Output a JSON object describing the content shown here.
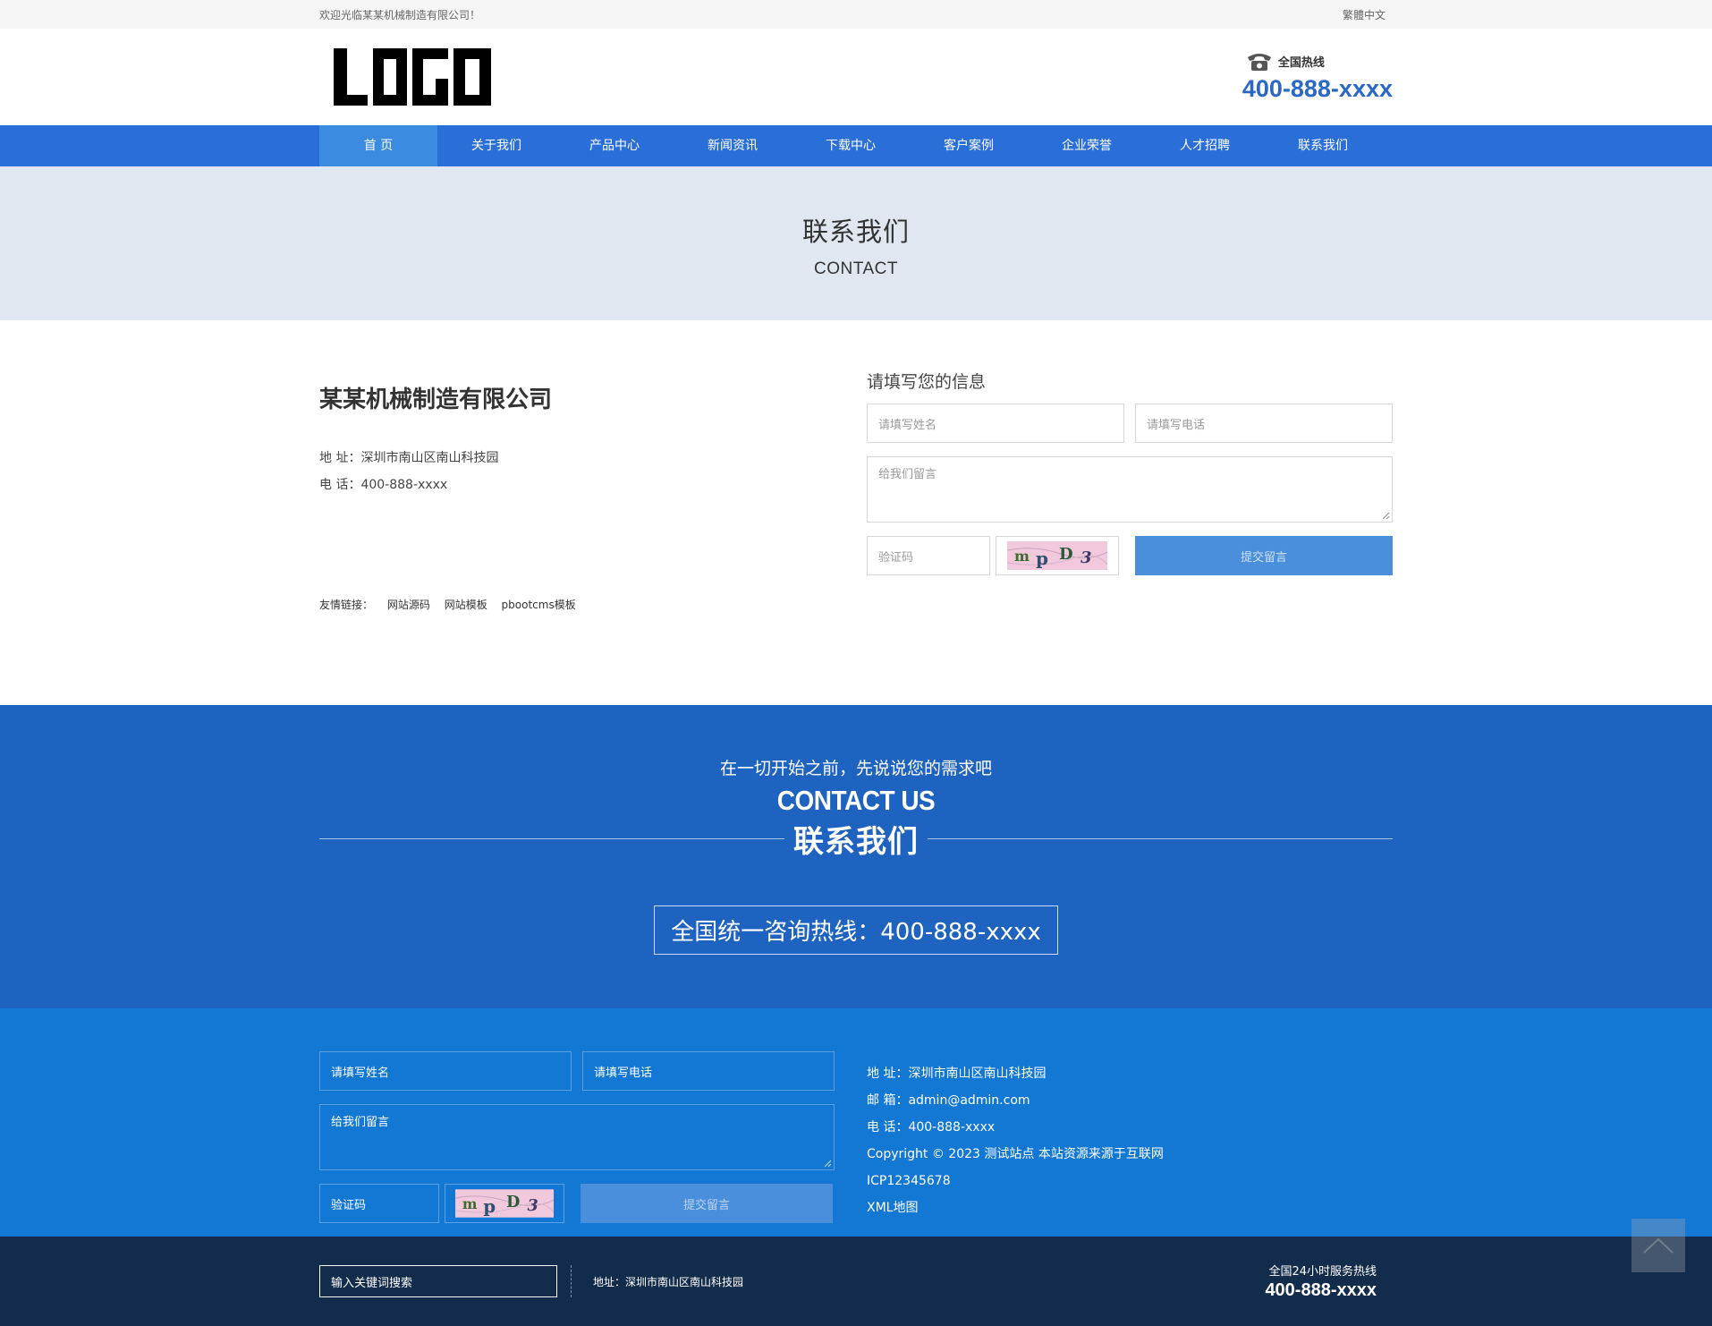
{
  "topbar": {
    "welcome": "欢迎光临某某机械制造有限公司！",
    "lang": "繁體中文"
  },
  "header": {
    "logo_text": "LOGO",
    "hotline_label": "全国热线",
    "hotline_number": "400-888-xxxx"
  },
  "nav": {
    "items": [
      "首 页",
      "关于我们",
      "产品中心",
      "新闻资讯",
      "下载中心",
      "客户案例",
      "企业荣誉",
      "人才招聘",
      "联系我们"
    ]
  },
  "banner": {
    "title": "联系我们",
    "subtitle": "CONTACT"
  },
  "company": {
    "name": "某某机械制造有限公司",
    "address": "地 址：深圳市南山区南山科技园",
    "phone": "电 话：400-888-xxxx"
  },
  "form": {
    "title": "请填写您的信息",
    "name_placeholder": "请填写姓名",
    "phone_placeholder": "请填写电话",
    "message_placeholder": "给我们留言",
    "code_placeholder": "验证码",
    "captcha_text": "mpD3",
    "submit_label": "提交留言"
  },
  "friend_links": {
    "label": "友情链接：",
    "links": [
      "网站源码",
      "网站模板",
      "pbootcms模板"
    ]
  },
  "band": {
    "lead": "在一切开始之前，先说说您的需求吧",
    "en": "CONTACT US",
    "cn": "联系我们",
    "hotline": "全国统一咨询热线：400-888-xxxx"
  },
  "footer_form": {
    "name_placeholder": "请填写姓名",
    "phone_placeholder": "请填写电话",
    "message_placeholder": "给我们留言",
    "code_placeholder": "验证码",
    "submit_label": "提交留言"
  },
  "footer_info": {
    "address": "地 址：深圳市南山区南山科技园",
    "email": "邮 箱：admin@admin.com",
    "phone": "电 话：400-888-xxxx",
    "copyright": "Copyright © 2023 测试站点 本站资源来源于互联网",
    "icp": "ICP12345678",
    "sitemap": "XML地图"
  },
  "bottom": {
    "search_placeholder": "输入关键词搜索",
    "address": "地址：深圳市南山区南山科技园",
    "hot_label": "全国24小时服务热线",
    "hot_number": "400-888-xxxx"
  },
  "colors": {
    "nav": "#2a6ed8",
    "accent": "#2a68c8",
    "band": "#1e63c0",
    "footer": "#1377d4",
    "bottom": "#132c4b"
  }
}
